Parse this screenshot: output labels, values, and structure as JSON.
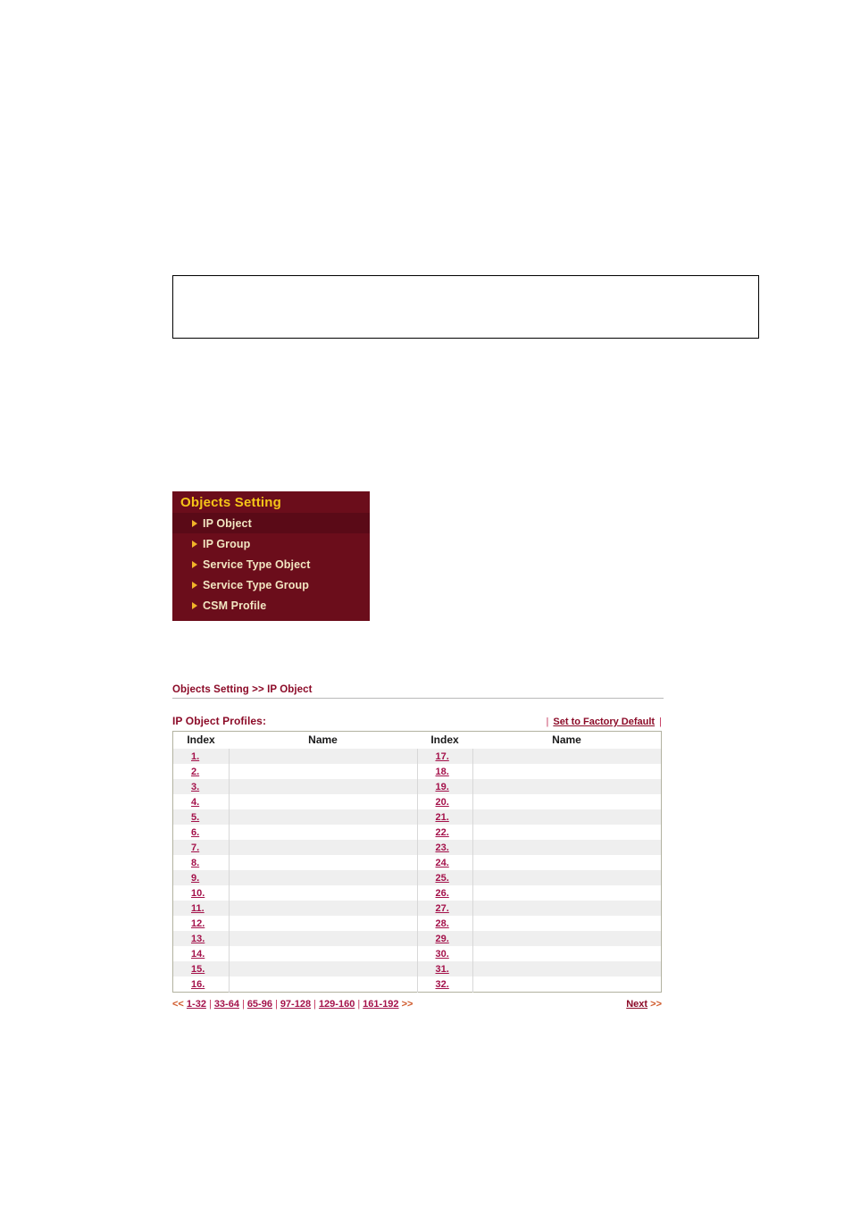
{
  "note_box": {
    "text": ""
  },
  "menu": {
    "title": "Objects Setting",
    "items": [
      {
        "label": "IP Object",
        "selected": true
      },
      {
        "label": "IP Group",
        "selected": false
      },
      {
        "label": "Service Type Object",
        "selected": false
      },
      {
        "label": "Service Type Group",
        "selected": false
      },
      {
        "label": "CSM Profile",
        "selected": false
      }
    ],
    "colors": {
      "panel_bg": "#6b0d1b",
      "selected_bg": "#5a0a17",
      "title_text": "#f5c518",
      "item_text": "#f2e6c2",
      "arrow": "#f0b429"
    }
  },
  "content": {
    "breadcrumb": "Objects Setting >> IP Object",
    "profiles_label": "IP Object Profiles:",
    "factory_default": {
      "left_pipe": "|",
      "link": "Set to Factory Default",
      "right_pipe": "|"
    },
    "table": {
      "headers": [
        "Index",
        "Name",
        "Index",
        "Name"
      ],
      "rows": [
        {
          "index_left": "1.",
          "name_left": "",
          "index_right": "17.",
          "name_right": ""
        },
        {
          "index_left": "2.",
          "name_left": "",
          "index_right": "18.",
          "name_right": ""
        },
        {
          "index_left": "3.",
          "name_left": "",
          "index_right": "19.",
          "name_right": ""
        },
        {
          "index_left": "4.",
          "name_left": "",
          "index_right": "20.",
          "name_right": ""
        },
        {
          "index_left": "5.",
          "name_left": "",
          "index_right": "21.",
          "name_right": ""
        },
        {
          "index_left": "6.",
          "name_left": "",
          "index_right": "22.",
          "name_right": ""
        },
        {
          "index_left": "7.",
          "name_left": "",
          "index_right": "23.",
          "name_right": ""
        },
        {
          "index_left": "8.",
          "name_left": "",
          "index_right": "24.",
          "name_right": ""
        },
        {
          "index_left": "9.",
          "name_left": "",
          "index_right": "25.",
          "name_right": ""
        },
        {
          "index_left": "10.",
          "name_left": "",
          "index_right": "26.",
          "name_right": ""
        },
        {
          "index_left": "11.",
          "name_left": "",
          "index_right": "27.",
          "name_right": ""
        },
        {
          "index_left": "12.",
          "name_left": "",
          "index_right": "28.",
          "name_right": ""
        },
        {
          "index_left": "13.",
          "name_left": "",
          "index_right": "29.",
          "name_right": ""
        },
        {
          "index_left": "14.",
          "name_left": "",
          "index_right": "30.",
          "name_right": ""
        },
        {
          "index_left": "15.",
          "name_left": "",
          "index_right": "31.",
          "name_right": ""
        },
        {
          "index_left": "16.",
          "name_left": "",
          "index_right": "32.",
          "name_right": ""
        }
      ]
    },
    "pagination": {
      "prev_arrow": "<<",
      "ranges": [
        "1-32",
        "33-64",
        "65-96",
        "97-128",
        "129-160",
        "161-192"
      ],
      "next_arrow": ">>",
      "separator": "|",
      "next_label": "Next",
      "next_chevron": ">>"
    }
  }
}
